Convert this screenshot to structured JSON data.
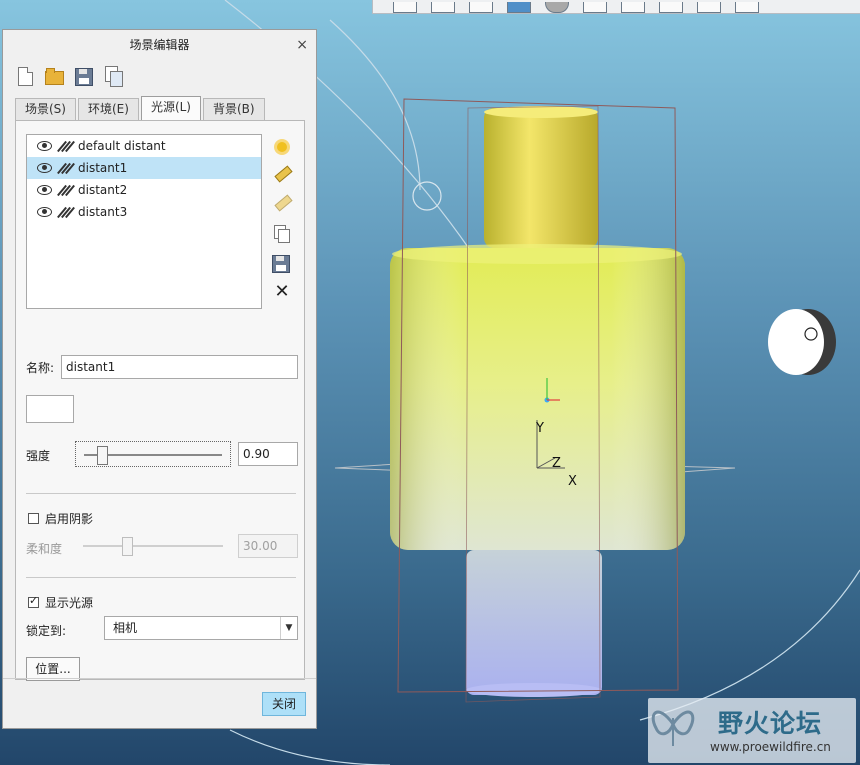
{
  "dialog": {
    "title": "场景编辑器",
    "close_glyph": "×"
  },
  "file_toolbar": {
    "icons": [
      "new-file-icon",
      "open-folder-icon",
      "save-icon",
      "copy-icon"
    ]
  },
  "tabs": [
    {
      "label": "场景(S)",
      "active": false
    },
    {
      "label": "环境(E)",
      "active": false
    },
    {
      "label": "光源(L)",
      "active": true
    },
    {
      "label": "背景(B)",
      "active": false
    }
  ],
  "lights": {
    "items": [
      {
        "name": "default distant",
        "selected": false
      },
      {
        "name": "distant1",
        "selected": true
      },
      {
        "name": "distant2",
        "selected": false
      },
      {
        "name": "distant3",
        "selected": false
      }
    ],
    "side_buttons": [
      "add-light-icon",
      "edit-light-icon",
      "edit-light-disabled-icon",
      "copy-light-icon",
      "save-light-icon",
      "delete-light-icon"
    ],
    "delete_glyph": "✕"
  },
  "properties": {
    "name_label": "名称:",
    "name_value": "distant1",
    "color_hex": "#ffffff",
    "intensity_label": "强度",
    "intensity_value": "0.90",
    "intensity_fraction": 0.1,
    "enable_shadow_label": "启用阴影",
    "enable_shadow_checked": false,
    "softness_label": "柔和度",
    "softness_value": "30.00",
    "softness_fraction": 0.3,
    "show_light_label": "显示光源",
    "show_light_checked": true,
    "lock_to_label": "锁定到:",
    "lock_to_value": "相机",
    "position_button": "位置..."
  },
  "footer": {
    "close_button": "关闭"
  },
  "viewport": {
    "axes": {
      "y": "Y",
      "z": "Z",
      "x": "X"
    },
    "part_top_color": "#e8f06a",
    "part_bottom_color": "#b3bcf0"
  },
  "watermark": {
    "title": "野火论坛",
    "url": "www.proewildfire.cn"
  }
}
